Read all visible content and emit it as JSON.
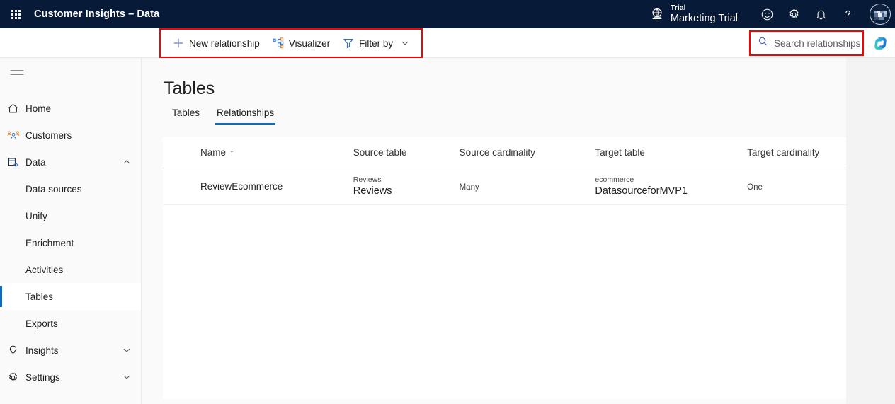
{
  "header": {
    "waffle_icon": "app-launcher-icon",
    "app_title": "Customer Insights – Data",
    "env": {
      "globe_icon": "globe-icon",
      "trial_label": "Trial",
      "trial_name": "Marketing Trial"
    },
    "icons": [
      {
        "name": "feedback-smiley-icon",
        "glyph": "smiley"
      },
      {
        "name": "settings-gear-icon",
        "glyph": "gear"
      },
      {
        "name": "notifications-bell-icon",
        "glyph": "bell"
      },
      {
        "name": "help-question-icon",
        "glyph": "question"
      }
    ],
    "avatar": {
      "name": "user-avatar",
      "label": ""
    }
  },
  "commandbar": {
    "new_relationship": {
      "label": "New relationship",
      "icon": "plus-icon"
    },
    "visualizer": {
      "label": "Visualizer",
      "icon": "share-graph-icon"
    },
    "filter_by": {
      "label": "Filter by",
      "icon": "filter-funnel-icon",
      "chevron": "chevron-down-icon"
    },
    "search": {
      "placeholder": "Search relationships",
      "icon": "search-icon",
      "value": ""
    },
    "copilot": {
      "label": "Copilot",
      "icon": "copilot-icon"
    },
    "highlight_color": "#FF0000"
  },
  "sidebar": {
    "hamburger": {
      "name": "hamburger-menu",
      "label": ""
    },
    "items": [
      {
        "label": "Home",
        "icon": "home-icon",
        "level": 0,
        "selected": false,
        "expandable": false
      },
      {
        "label": "Customers",
        "icon": "people-icon",
        "level": 0,
        "selected": false,
        "expandable": false
      },
      {
        "label": "Data",
        "icon": "database-icon",
        "level": 0,
        "selected": false,
        "expandable": true,
        "expanded": true
      },
      {
        "label": "Data sources",
        "icon": "",
        "level": 1,
        "selected": false,
        "expandable": false
      },
      {
        "label": "Unify",
        "icon": "",
        "level": 1,
        "selected": false,
        "expandable": false
      },
      {
        "label": "Enrichment",
        "icon": "",
        "level": 1,
        "selected": false,
        "expandable": false
      },
      {
        "label": "Activities",
        "icon": "",
        "level": 1,
        "selected": false,
        "expandable": false
      },
      {
        "label": "Tables",
        "icon": "",
        "level": 1,
        "selected": true,
        "expandable": false
      },
      {
        "label": "Exports",
        "icon": "",
        "level": 1,
        "selected": false,
        "expandable": false
      },
      {
        "label": "Insights",
        "icon": "lightbulb-icon",
        "level": 0,
        "selected": false,
        "expandable": true,
        "expanded": false
      },
      {
        "label": "Settings",
        "icon": "gear-icon",
        "level": 0,
        "selected": false,
        "expandable": true,
        "expanded": false
      }
    ],
    "accent_color": "#0f6cbd"
  },
  "main": {
    "page_title": "Tables",
    "tabs": [
      {
        "label": "Tables",
        "active": false
      },
      {
        "label": "Relationships",
        "active": true
      }
    ],
    "table": {
      "columns": [
        {
          "label": "Name",
          "sort": "↑"
        },
        {
          "label": "Source table",
          "sort": ""
        },
        {
          "label": "Source cardinality",
          "sort": ""
        },
        {
          "label": "Target table",
          "sort": ""
        },
        {
          "label": "Target cardinality",
          "sort": ""
        }
      ],
      "rows": [
        {
          "name": "ReviewEcommerce",
          "source_table_source": "Reviews",
          "source_table_name": "Reviews",
          "source_cardinality": "Many",
          "target_table_source": "ecommerce",
          "target_table_name": "DatasourceforMVP1",
          "target_cardinality": "One"
        }
      ]
    }
  }
}
